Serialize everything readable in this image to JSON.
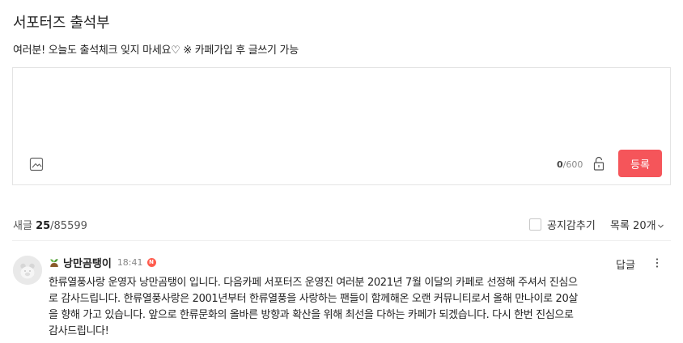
{
  "page": {
    "title": "서포터즈 출석부",
    "notice": "여러분! 오늘도 출석체크 잊지 마세요♡ ※ 카페가입 후 글쓰기 가능"
  },
  "editor": {
    "text_value": "",
    "char_count": "0",
    "char_max": "/600",
    "submit_label": "등록",
    "icons": [
      "image-icon",
      "lock-icon"
    ]
  },
  "list_header": {
    "new_label": "새글",
    "new_count": "25",
    "total": "/85599",
    "notice_hide_label": "공지감추기",
    "notice_hide_checked": false,
    "list_size_label": "목록 20개"
  },
  "comments": [
    {
      "nickname": "낭만곰탱이",
      "time": "18:41",
      "badge": "N",
      "reply_label": "답글",
      "text": "한류열풍사랑 운영자 낭만곰탱이 입니다. 다음카페 서포터즈 운영진 여러분 2021년 7월 이달의 카페로 선정해 주셔서 진심으로 감사드립니다. 한류열풍사랑은 2001년부터 한류열풍을 사랑하는 팬들이 함께해온 오랜 커뮤니티로서 올해 만나이로 20살을 향해 가고 있습니다. 앞으로 한류문화의 올바른 방향과 확산을 위해 최선을 다하는 카페가 되겠습니다. 다시 한번 진심으로 감사드립니다!"
    }
  ],
  "colors": {
    "submit_bg": "#f5555a",
    "new_badge": "#ff5c4e",
    "border": "#e4e4e4"
  }
}
